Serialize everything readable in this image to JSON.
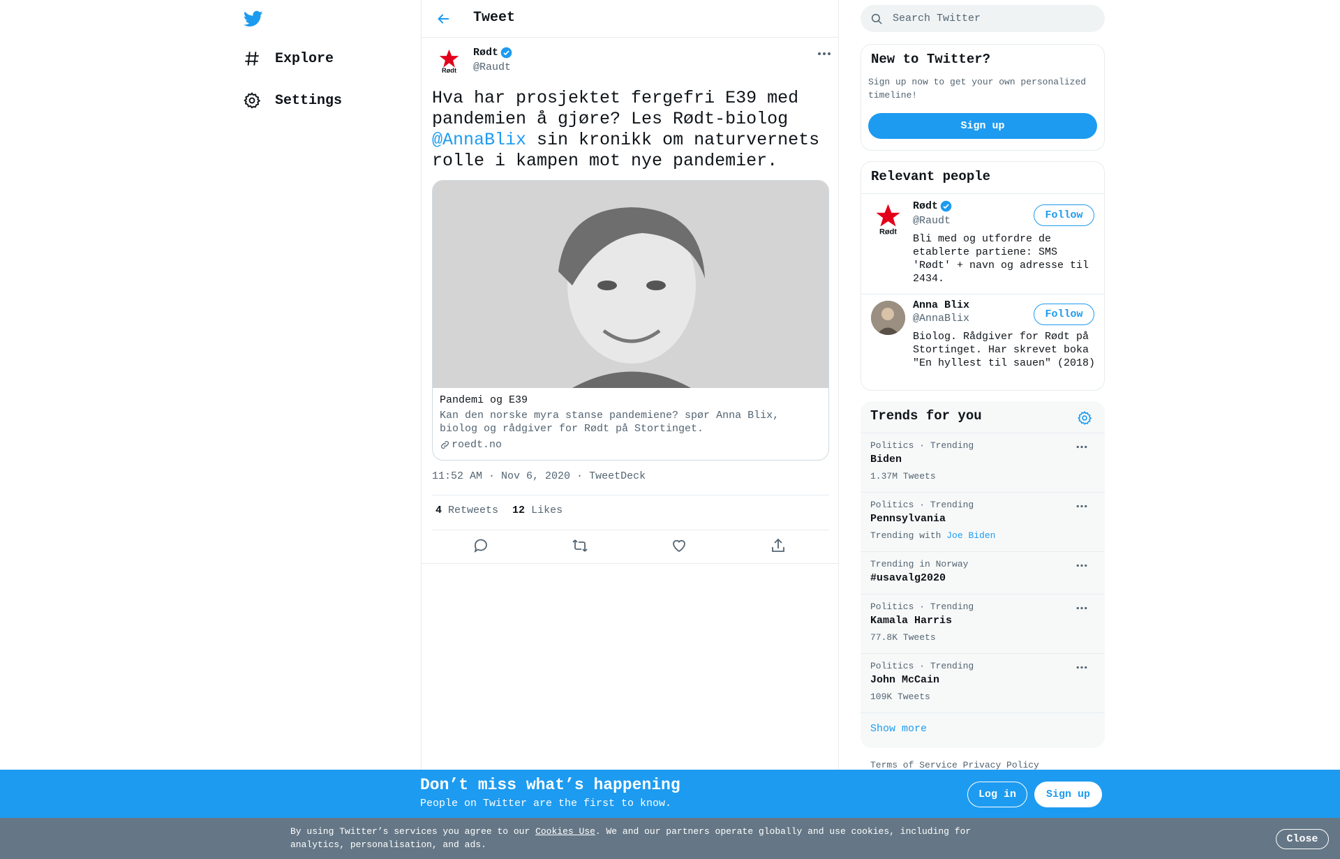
{
  "nav": {
    "items": [
      {
        "label": "Explore",
        "icon": "hashtag-icon"
      },
      {
        "label": "Settings",
        "icon": "gear-icon"
      }
    ]
  },
  "header": {
    "title": "Tweet"
  },
  "tweet": {
    "author_name": "Rødt",
    "author_handle": "@Raudt",
    "avatar_text": "Rødt",
    "text_part1": "Hva har prosjektet fergefri E39 med pandemien å gjøre? Les Rødt-biolog ",
    "mention": "@AnnaBlix",
    "text_part2": " sin kronikk om naturvernets rolle i kampen mot nye pandemier.",
    "card": {
      "title": "Pandemi og E39",
      "description": "Kan den norske myra stanse pandemiene? spør Anna Blix, biolog og rådgiver for Rødt på Stortinget.",
      "domain": "roedt.no"
    },
    "timestamp": "11:52 AM · Nov 6, 2020",
    "source": "TweetDeck",
    "retweets_count": "4",
    "retweets_label": "Retweets",
    "likes_count": "12",
    "likes_label": "Likes"
  },
  "search": {
    "placeholder": "Search Twitter"
  },
  "signup_panel": {
    "title": "New to Twitter?",
    "subtitle": "Sign up now to get your own personalized timeline!",
    "button": "Sign up"
  },
  "relevant_people": {
    "title": "Relevant people",
    "people": [
      {
        "name": "Rødt",
        "handle": "@Raudt",
        "bio": "Bli med og utfordre de etablerte partiene: SMS 'Rødt' + navn og adresse til 2434.",
        "button": "Follow",
        "avatar_text": "Rødt"
      },
      {
        "name": "Anna Blix",
        "handle": "@AnnaBlix",
        "bio": "Biolog. Rådgiver for Rødt på Stortinget. Har skrevet boka \"En hyllest til sauen\" (2018)",
        "button": "Follow"
      }
    ]
  },
  "trends": {
    "title": "Trends for you",
    "items": [
      {
        "meta": "Politics · Trending",
        "name": "Biden",
        "count": "1.37M Tweets"
      },
      {
        "meta": "Politics · Trending",
        "name": "Pennsylvania",
        "with_label": "Trending with",
        "with_link": "Joe Biden"
      },
      {
        "meta": "Trending in Norway",
        "name": "#usavalg2020"
      },
      {
        "meta": "Politics · Trending",
        "name": "Kamala Harris",
        "count": "77.8K Tweets"
      },
      {
        "meta": "Politics · Trending",
        "name": "John McCain",
        "count": "109K Tweets"
      }
    ],
    "show_more": "Show more"
  },
  "footer": {
    "terms": "Terms of Service",
    "privacy": "Privacy Policy"
  },
  "bottom_bar": {
    "title": "Don’t miss what’s happening",
    "subtitle": "People on Twitter are the first to know.",
    "login": "Log in",
    "signup": "Sign up"
  },
  "cookie_bar": {
    "text_before": "By using Twitter’s services you agree to our ",
    "link": "Cookies Use",
    "text_after": ". We and our partners operate globally and use cookies, including for analytics, personalisation, and ads.",
    "close": "Close"
  },
  "colors": {
    "accent": "#1d9bf0",
    "cookie_bar": "#657786",
    "brand_red": "#e2001a"
  }
}
